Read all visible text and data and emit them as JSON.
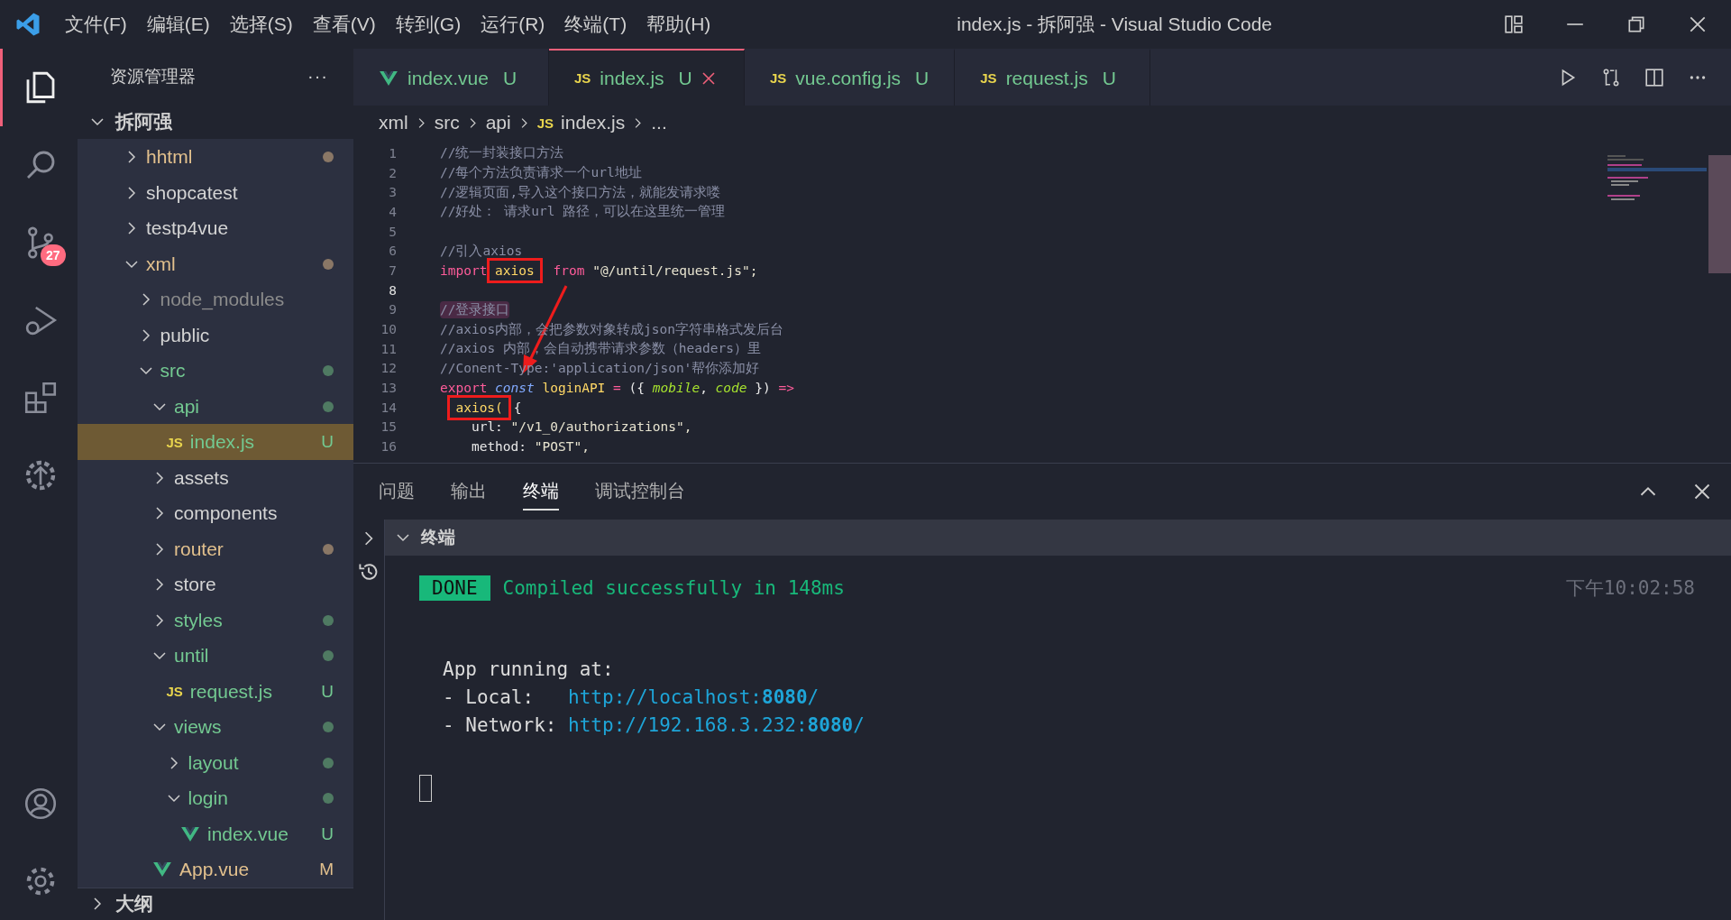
{
  "title_bar": {
    "menu": [
      "文件(F)",
      "编辑(E)",
      "选择(S)",
      "查看(V)",
      "转到(G)",
      "运行(R)",
      "终端(T)",
      "帮助(H)"
    ],
    "title": "index.js - 拆阿强 - Visual Studio Code"
  },
  "activity_bar": {
    "items": [
      {
        "kind": "explorer",
        "selected": true
      },
      {
        "kind": "search",
        "selected": false
      },
      {
        "kind": "source-control",
        "selected": false,
        "badge": "27"
      },
      {
        "kind": "run",
        "selected": false
      },
      {
        "kind": "extensions",
        "selected": false
      },
      {
        "kind": "remote",
        "selected": false
      }
    ],
    "bottom": [
      {
        "kind": "account"
      },
      {
        "kind": "settings"
      }
    ]
  },
  "explorer": {
    "title": "资源管理器",
    "more": "···",
    "workspace": {
      "name": "拆阿强",
      "expanded": true
    },
    "tree": [
      {
        "name": "hhtml",
        "kind": "folder",
        "expanded": false,
        "color": "#e2c08d",
        "dot": {
          "color": "#8a7766"
        }
      },
      {
        "name": "shopcatest",
        "kind": "folder",
        "expanded": false,
        "color": "#d4d4d4"
      },
      {
        "name": "testp4vue",
        "kind": "folder",
        "expanded": false,
        "color": "#d4d4d4"
      },
      {
        "name": "xml",
        "kind": "folder",
        "expanded": true,
        "color": "#e2c08d",
        "dot": {
          "color": "#8a7766"
        },
        "children": [
          {
            "name": "node_modules",
            "kind": "folder",
            "expanded": false,
            "color": "#8b8b8b"
          },
          {
            "name": "public",
            "kind": "folder",
            "expanded": false,
            "color": "#d4d4d4"
          },
          {
            "name": "src",
            "kind": "folder",
            "expanded": true,
            "color": "#73c991",
            "dot": {
              "color": "#4f7a62"
            },
            "children": [
              {
                "name": "api",
                "kind": "folder",
                "expanded": true,
                "color": "#73c991",
                "dot": {
                  "color": "#4f7a62"
                },
                "children": [
                  {
                    "name": "index.js",
                    "kind": "js",
                    "icon": "JS",
                    "color": "#73c991",
                    "badge": "U",
                    "selected": true
                  }
                ]
              },
              {
                "name": "assets",
                "kind": "folder",
                "expanded": false,
                "color": "#d4d4d4"
              },
              {
                "name": "components",
                "kind": "folder",
                "expanded": false,
                "color": "#d4d4d4"
              },
              {
                "name": "router",
                "kind": "folder",
                "expanded": false,
                "color": "#e2c08d",
                "dot": {
                  "color": "#8a7766"
                }
              },
              {
                "name": "store",
                "kind": "folder",
                "expanded": false,
                "color": "#d4d4d4"
              },
              {
                "name": "styles",
                "kind": "folder",
                "expanded": false,
                "color": "#73c991",
                "dot": {
                  "color": "#4f7a62"
                }
              },
              {
                "name": "until",
                "kind": "folder",
                "expanded": true,
                "color": "#73c991",
                "dot": {
                  "color": "#4f7a62"
                },
                "children": [
                  {
                    "name": "request.js",
                    "kind": "js",
                    "icon": "JS",
                    "color": "#73c991",
                    "badge": "U",
                    "selected": false
                  }
                ]
              },
              {
                "name": "views",
                "kind": "folder",
                "expanded": true,
                "color": "#73c991",
                "dot": {
                  "color": "#4f7a62"
                },
                "children": [
                  {
                    "name": "layout",
                    "kind": "folder",
                    "expanded": false,
                    "color": "#73c991",
                    "dot": {
                      "color": "#4f7a62"
                    }
                  },
                  {
                    "name": "login",
                    "kind": "folder",
                    "expanded": true,
                    "color": "#73c991",
                    "dot": {
                      "color": "#4f7a62"
                    },
                    "children": [
                      {
                        "name": "index.vue",
                        "kind": "vue",
                        "color": "#73c991",
                        "badge": "U",
                        "selected": false
                      }
                    ]
                  }
                ]
              },
              {
                "name": "App.vue",
                "kind": "vue",
                "color": "#e2c08d",
                "badge": "M",
                "selected": false
              }
            ]
          }
        ]
      }
    ],
    "outline": {
      "label": "大纲",
      "expanded": false
    }
  },
  "editor_tabs": [
    {
      "name": "index.vue",
      "kind": "vue",
      "badge": "U",
      "selected": false
    },
    {
      "name": "index.js",
      "kind": "js",
      "icon": "JS",
      "badge": "U",
      "selected": true
    },
    {
      "name": "vue.config.js",
      "kind": "js",
      "icon": "JS",
      "badge": "U",
      "selected": false
    },
    {
      "name": "request.js",
      "kind": "js",
      "icon": "JS",
      "badge": "U",
      "selected": false
    }
  ],
  "breadcrumb": {
    "parts": [
      "xml",
      "src",
      "api"
    ],
    "file": "index.js",
    "file_icon": "JS",
    "tail": "..."
  },
  "code": {
    "annotation_arrow": true,
    "lines": [
      {
        "number": "1",
        "tokens": [
          {
            "text": "//统一封装接口方法",
            "kind": "comment"
          }
        ]
      },
      {
        "number": "2",
        "tokens": [
          {
            "text": "//每个方法负责请求一个url地址",
            "kind": "comment"
          }
        ]
      },
      {
        "number": "3",
        "tokens": [
          {
            "text": "//逻辑页面,导入这个接口方法，就能发请求喽",
            "kind": "comment"
          }
        ]
      },
      {
        "number": "4",
        "tokens": [
          {
            "text": "//好处： 请求url 路径，可以在这里统一管理",
            "kind": "comment"
          }
        ]
      },
      {
        "number": "5"
      },
      {
        "number": "6",
        "tokens": [
          {
            "text": "//引入axios",
            "kind": "comment"
          }
        ]
      },
      {
        "number": "7",
        "tokens": [
          {
            "text": "import ",
            "kind": "keyword"
          },
          {
            "text": "axios",
            "kind": "ident",
            "marked": true
          },
          {
            "text": " from",
            "kind": "keyword"
          },
          {
            "text": " \"@/until/request.js\";",
            "kind": "string"
          }
        ]
      },
      {
        "number": "8",
        "current": true
      },
      {
        "number": "9",
        "highlighted": true,
        "tokens": [
          {
            "text": "//登录接口",
            "kind": "comment"
          }
        ]
      },
      {
        "number": "10",
        "tokens": [
          {
            "text": "//axios内部，会把参数对象转成json字符串格式发后台",
            "kind": "comment"
          }
        ]
      },
      {
        "number": "11",
        "tokens": [
          {
            "text": "//axios 内部，会自动携带请求参数（headers）里",
            "kind": "comment"
          }
        ]
      },
      {
        "number": "12",
        "tokens": [
          {
            "text": "//Conent-Type:'application/json'帮你添加好",
            "kind": "comment"
          }
        ]
      },
      {
        "number": "13",
        "tokens": [
          {
            "text": "export ",
            "kind": "keyword"
          },
          {
            "text": "const ",
            "kind": "storage"
          },
          {
            "text": "loginAPI",
            "kind": "ident"
          },
          {
            "text": " = ",
            "kind": "operator"
          },
          {
            "text": "({ ",
            "kind": "plain"
          },
          {
            "text": "mobile",
            "kind": "param"
          },
          {
            "text": ", ",
            "kind": "plain"
          },
          {
            "text": "code",
            "kind": "param"
          },
          {
            "text": " }) ",
            "kind": "plain"
          },
          {
            "text": "=>",
            "kind": "operator"
          }
        ]
      },
      {
        "number": "14",
        "indented": true,
        "tokens": [
          {
            "text": "axios(",
            "kind": "ident",
            "marked": true
          },
          {
            "text": "{",
            "kind": "plain"
          }
        ]
      },
      {
        "number": "15",
        "tokens": [
          {
            "text": "    url: ",
            "kind": "plain"
          },
          {
            "text": "\"/v1_0/authorizations\",",
            "kind": "string"
          }
        ]
      },
      {
        "number": "16",
        "tokens": [
          {
            "text": "    method: ",
            "kind": "plain"
          },
          {
            "text": "\"POST\",",
            "kind": "string"
          }
        ]
      }
    ]
  },
  "panel": {
    "tabs": [
      {
        "label": "问题",
        "selected": false
      },
      {
        "label": "输出",
        "selected": false
      },
      {
        "label": "终端",
        "selected": true
      },
      {
        "label": "调试控制台",
        "selected": false
      }
    ],
    "terminal_title": "终端",
    "terminal": {
      "badge": "DONE",
      "message": "Compiled successfully in 148ms",
      "time": "下午10:02:58",
      "lines": [
        {
          "kind": "text",
          "text": "App running at:"
        },
        {
          "kind": "link",
          "label": "- Local:   ",
          "url": "http://localhost:**8080**/"
        },
        {
          "kind": "link",
          "label": "- Network: ",
          "url": "http://192.168.3.232:**8080**/"
        }
      ]
    }
  }
}
